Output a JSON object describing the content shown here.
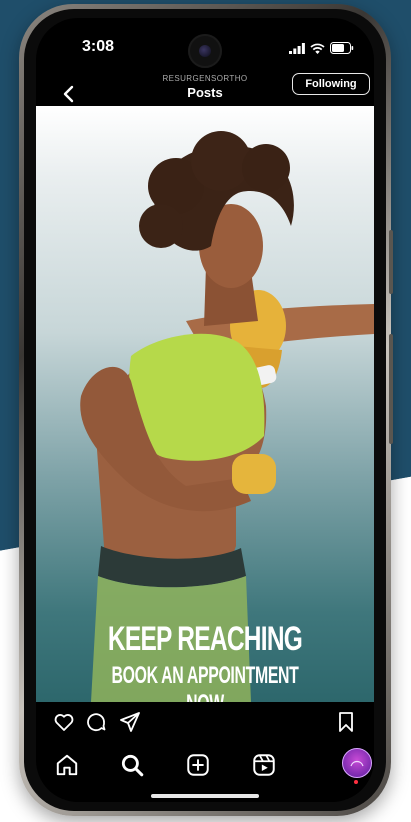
{
  "status_bar": {
    "time": "3:08"
  },
  "header": {
    "account": "RESURGENSORTHO",
    "title": "Posts",
    "follow_label": "Following"
  },
  "post": {
    "headline": "KEEP REACHING",
    "subline": "BOOK AN APPOINTMENT NOW"
  },
  "actions": [
    "heart-icon",
    "comment-icon",
    "share-icon",
    "bookmark-icon"
  ],
  "tabs": [
    "home-icon",
    "search-icon",
    "create-icon",
    "reels-icon",
    "profile-avatar"
  ],
  "colors": {
    "background_blue": "#1f4e6a",
    "screen": "#000000",
    "notification_dot": "#ff3040",
    "text": "#ffffff"
  }
}
